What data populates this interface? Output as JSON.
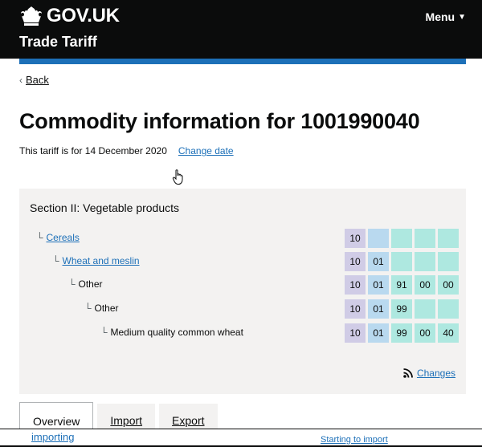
{
  "header": {
    "brand": "GOV.UK",
    "service": "Trade Tariff",
    "menu_label": "Menu",
    "crown_icon": "crown-icon",
    "caret_icon": "caret-down-icon",
    "colors": {
      "header_bg": "#0b0c0c",
      "accent": "#1d70b8"
    }
  },
  "back": {
    "label": "Back"
  },
  "page": {
    "title": "Commodity information for 1001990040",
    "date_text": "This tariff is for 14 December 2020",
    "change_date": "Change date"
  },
  "section": {
    "title": "Section II: Vegetable products",
    "rows": [
      {
        "label": "Cereals",
        "link": true,
        "codes": [
          "10",
          "",
          "",
          "",
          ""
        ]
      },
      {
        "label": "Wheat and meslin",
        "link": true,
        "codes": [
          "10",
          "01",
          "",
          "",
          ""
        ]
      },
      {
        "label": "Other",
        "link": false,
        "codes": [
          "10",
          "01",
          "91",
          "00",
          "00"
        ]
      },
      {
        "label": "Other",
        "link": false,
        "codes": [
          "10",
          "01",
          "99",
          "",
          ""
        ]
      },
      {
        "label": "Medium quality common wheat",
        "link": false,
        "codes": [
          "10",
          "01",
          "99",
          "00",
          "40"
        ]
      }
    ],
    "tree_glyph": "└",
    "changes_label": "Changes",
    "code_colors": {
      "chapter": "#d0cce6",
      "heading": "#b9d9ef",
      "subheading": "#aee8e0"
    }
  },
  "tabs": [
    {
      "label": "Overview",
      "active": true
    },
    {
      "label": "Import",
      "active": false
    },
    {
      "label": "Export",
      "active": false
    }
  ],
  "bottom": {
    "left_link": "importing",
    "right_link": "Starting to import"
  }
}
